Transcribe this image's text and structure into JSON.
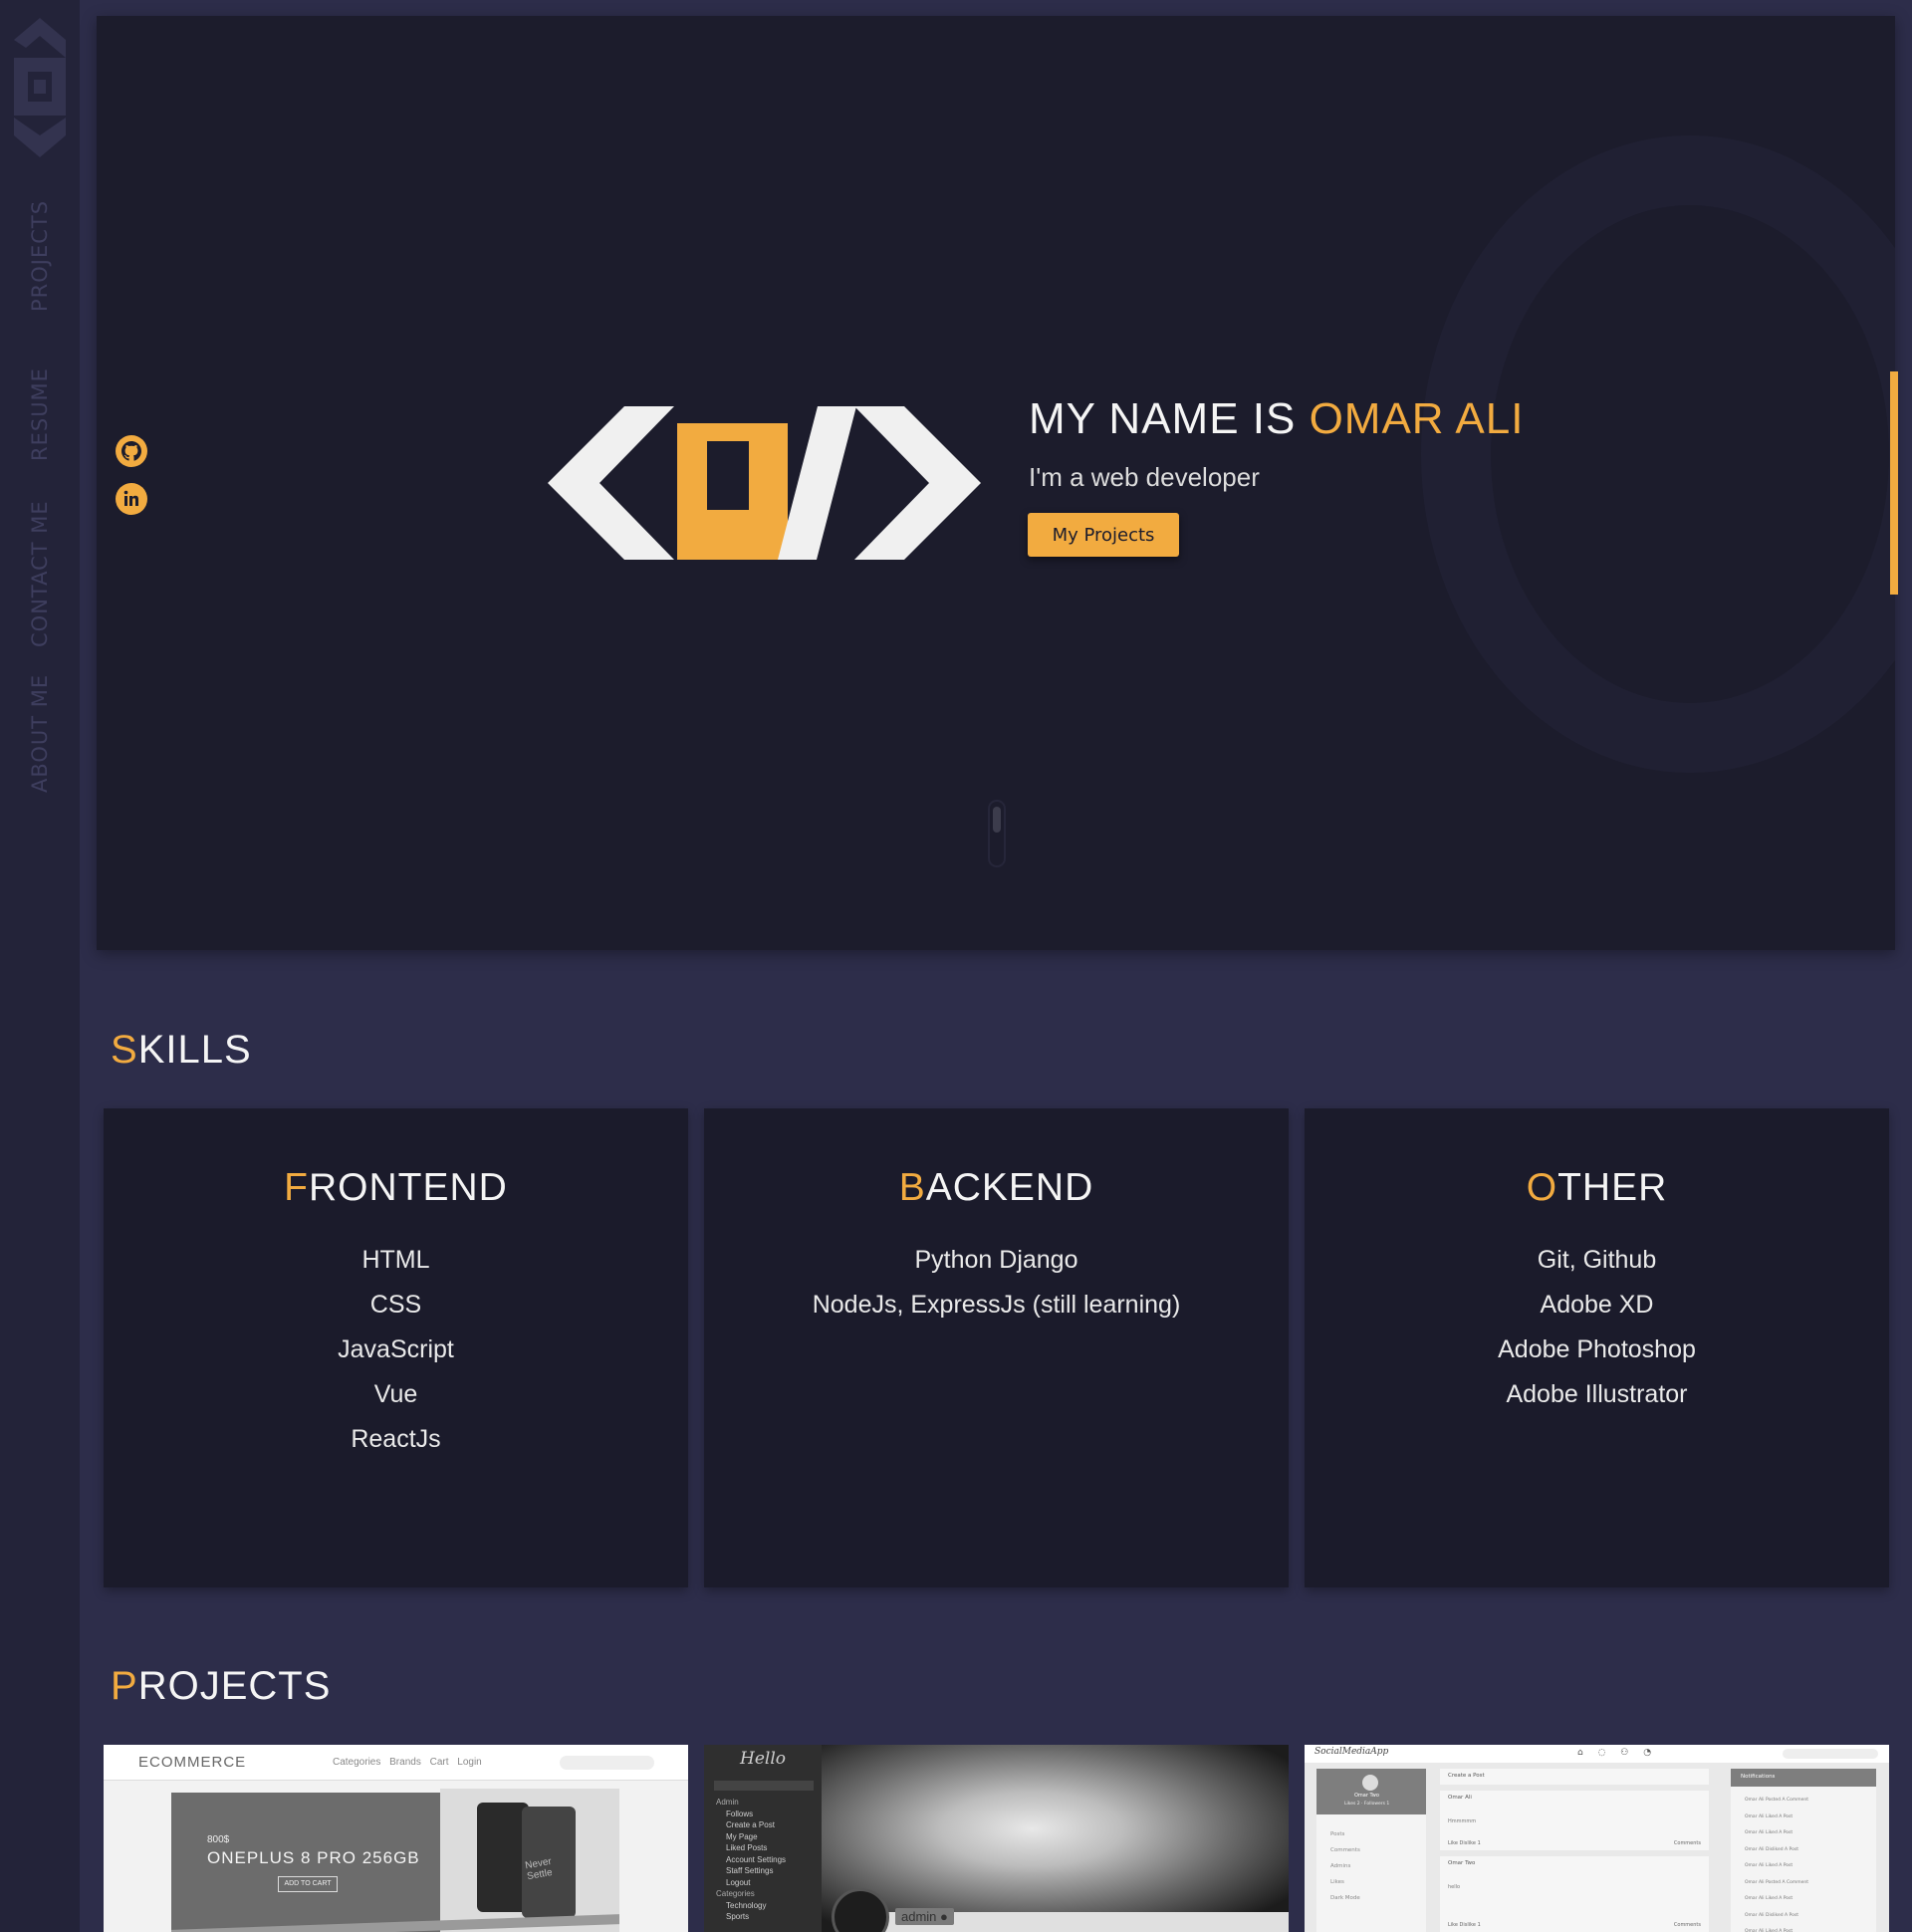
{
  "sidebar": {
    "nav": [
      "PROJECTS",
      "RESUME",
      "CONTACT ME",
      "ABOUT ME"
    ]
  },
  "hero": {
    "title_prefix": "MY NAME IS ",
    "title_name": "OMAR ALI",
    "subtitle": "I'm a web developer",
    "button_label": "My Projects",
    "social": [
      "github-icon",
      "linkedin-icon"
    ]
  },
  "skills": {
    "title_first": "S",
    "title_rest": "KILLS",
    "cards": [
      {
        "title_first": "F",
        "title_rest": "RONTEND",
        "items": [
          "HTML",
          "CSS",
          "JavaScript",
          "Vue",
          "ReactJs"
        ]
      },
      {
        "title_first": "B",
        "title_rest": "ACKEND",
        "items": [
          "Python Django",
          "NodeJs, ExpressJs (still learning)"
        ]
      },
      {
        "title_first": "O",
        "title_rest": "THER",
        "items": [
          "Git, Github",
          "Adobe XD",
          "Adobe Photoshop",
          "Adobe Illustrator"
        ]
      }
    ]
  },
  "projects": {
    "title_first": "P",
    "title_rest": "ROJECTS",
    "p1": {
      "brand": "ECOMMERCE",
      "nav": "Categories Brands Cart Login",
      "price": "800$",
      "product": "ONEPLUS 8 PRO 256GB",
      "cart": "ADD TO CART",
      "phone_text": "Never Settle"
    },
    "p2": {
      "hello": "Hello",
      "menu": [
        "Admin",
        "Follows",
        "Create a Post",
        "My Page",
        "Liked Posts",
        "Account Settings",
        "Staff Settings",
        "Logout",
        "Categories",
        "Technology",
        "Sports"
      ],
      "admin": "admin ●"
    },
    "p3": {
      "brand": "SocialMediaApp",
      "icons": "⌂ ◌ ⚇ ◔",
      "user": "Omar Two",
      "stats": "Likes 2 · Followers 1",
      "menu": [
        "Posts",
        "Comments",
        "Admins",
        "Likes",
        "Dark Mode"
      ],
      "create": "Create a Post",
      "post1_author": "Omar Ali",
      "post1_body": "Hmmmmm",
      "post2_author": "Omar Two",
      "post2_body": "hello",
      "like_row": "Like   Dislike   1",
      "comments": "Comments",
      "notif_title": "Notifications",
      "notifications": [
        "Omar Ali Posted A Comment",
        "Omar Ali Liked A Post",
        "Omar Ali Liked A Post",
        "Omar Ali Disliked A Post",
        "Omar Ali Liked A Post",
        "Omar Ali Posted A Comment",
        "Omar Ali Liked A Post",
        "Omar Ali Disliked A Post",
        "Omar Ali Liked A Post"
      ]
    }
  },
  "colors": {
    "accent": "#f2ab40",
    "background": "#2d2d4a",
    "panel": "#1c1c2c"
  }
}
